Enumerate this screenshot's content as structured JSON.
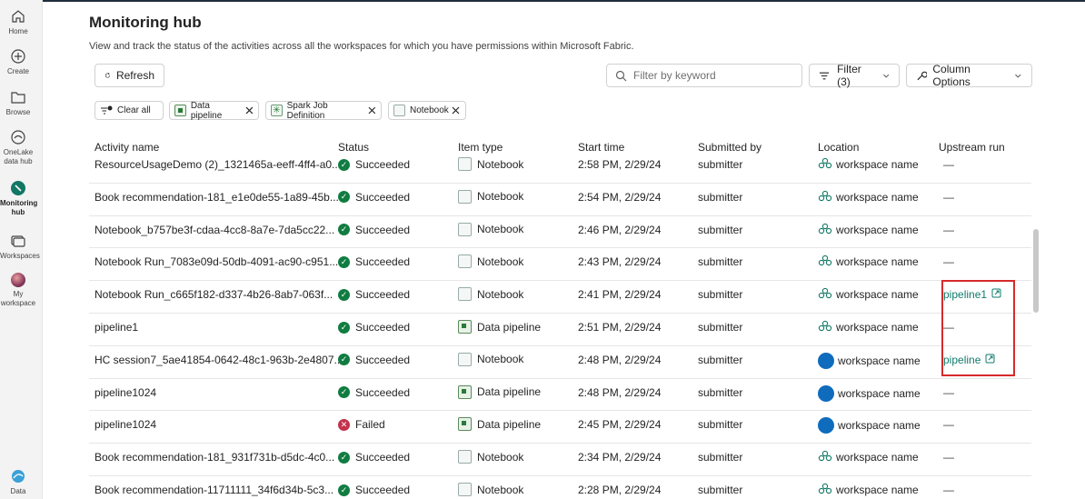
{
  "rail": {
    "items": [
      {
        "label": "Home",
        "icon": "home-icon"
      },
      {
        "label": "Create",
        "icon": "create-icon"
      },
      {
        "label": "Browse",
        "icon": "browse-icon"
      },
      {
        "label": "OneLake data hub",
        "line1": "OneLake",
        "line2": "data hub",
        "icon": "onelake-icon"
      },
      {
        "label": "Monitoring hub",
        "line1": "Monitoring",
        "line2": "hub",
        "icon": "monitoring-icon",
        "active": true
      },
      {
        "label": "Workspaces",
        "icon": "workspaces-icon"
      },
      {
        "label": "My workspace",
        "line1": "My",
        "line2": "workspace",
        "icon": "avatar"
      },
      {
        "label": "Data",
        "icon": "data-icon"
      }
    ]
  },
  "header": {
    "title": "Monitoring hub",
    "subtitle": "View and track the status of the activities across all the workspaces for which you have permissions within Microsoft Fabric."
  },
  "toolbar": {
    "refresh_label": "Refresh",
    "search_placeholder": "Filter by keyword",
    "filter_label": "Filter (3)",
    "column_options_label": "Column Options"
  },
  "filters": {
    "clear_all_label": "Clear all",
    "chips": [
      {
        "label": "Data pipeline",
        "icon": "data-pipeline-icon"
      },
      {
        "label": "Spark Job Definition",
        "icon": "spark-job-icon"
      },
      {
        "label": "Notebook",
        "icon": "notebook-icon"
      }
    ]
  },
  "table": {
    "columns": [
      "Activity name",
      "Status",
      "Item type",
      "Start time",
      "Submitted by",
      "Location",
      "Upstream run"
    ],
    "rows": [
      {
        "name": "ResourceUsageDemo (2)_1321465a-eeff-4ff4-a0...",
        "status": "Succeeded",
        "type": "Notebook",
        "start": "2:58 PM, 2/29/24",
        "submitter": "submitter",
        "location": "workspace name",
        "loc_icon": "multi",
        "upstream": "—"
      },
      {
        "name": "Book recommendation-181_e1e0de55-1a89-45b...",
        "status": "Succeeded",
        "type": "Notebook",
        "start": "2:54 PM, 2/29/24",
        "submitter": "submitter",
        "location": "workspace name",
        "loc_icon": "multi",
        "upstream": "—"
      },
      {
        "name": "Notebook_b757be3f-cdaa-4cc8-8a7e-7da5cc22...",
        "status": "Succeeded",
        "type": "Notebook",
        "start": "2:46 PM, 2/29/24",
        "submitter": "submitter",
        "location": "workspace name",
        "loc_icon": "multi",
        "upstream": "—"
      },
      {
        "name": "Notebook Run_7083e09d-50db-4091-ac90-c951...",
        "status": "Succeeded",
        "type": "Notebook",
        "start": "2:43 PM, 2/29/24",
        "submitter": "submitter",
        "location": "workspace name",
        "loc_icon": "multi",
        "upstream": "—"
      },
      {
        "name": "Notebook Run_c665f182-d337-4b26-8ab7-063f...",
        "status": "Succeeded",
        "type": "Notebook",
        "start": "2:41 PM, 2/29/24",
        "submitter": "submitter",
        "location": "workspace name",
        "loc_icon": "multi",
        "upstream": "pipeline1",
        "upstream_link": true
      },
      {
        "name": "pipeline1",
        "status": "Succeeded",
        "type": "Data pipeline",
        "start": "2:51 PM, 2/29/24",
        "submitter": "submitter",
        "location": "workspace name",
        "loc_icon": "multi",
        "upstream": "—"
      },
      {
        "name": "HC session7_5ae41854-0642-48c1-963b-2e4807...",
        "status": "Succeeded",
        "type": "Notebook",
        "start": "2:48 PM, 2/29/24",
        "submitter": "submitter",
        "location": "workspace name",
        "loc_icon": "dot",
        "upstream": "pipeline",
        "upstream_link": true
      },
      {
        "name": "pipeline1024",
        "status": "Succeeded",
        "type": "Data pipeline",
        "start": "2:48 PM, 2/29/24",
        "submitter": "submitter",
        "location": "workspace name",
        "loc_icon": "dot",
        "upstream": "—"
      },
      {
        "name": "pipeline1024",
        "status": "Failed",
        "type": "Data pipeline",
        "start": "2:45 PM, 2/29/24",
        "submitter": "submitter",
        "location": "workspace name",
        "loc_icon": "dot",
        "upstream": "—"
      },
      {
        "name": "Book recommendation-181_931f731b-d5dc-4c0...",
        "status": "Succeeded",
        "type": "Notebook",
        "start": "2:34 PM, 2/29/24",
        "submitter": "submitter",
        "location": "workspace name",
        "loc_icon": "multi",
        "upstream": "—"
      },
      {
        "name": "Book recommendation-11711111_34f6d34b-5c3...",
        "status": "Succeeded",
        "type": "Notebook",
        "start": "2:28 PM, 2/29/24",
        "submitter": "submitter",
        "location": "workspace name",
        "loc_icon": "multi",
        "upstream": "—"
      }
    ]
  },
  "colors": {
    "success": "#107c41",
    "failed": "#c4314b",
    "link": "#0f7b6b",
    "workspace_dot": "#0f6cbd",
    "highlight": "#d52b2b"
  }
}
